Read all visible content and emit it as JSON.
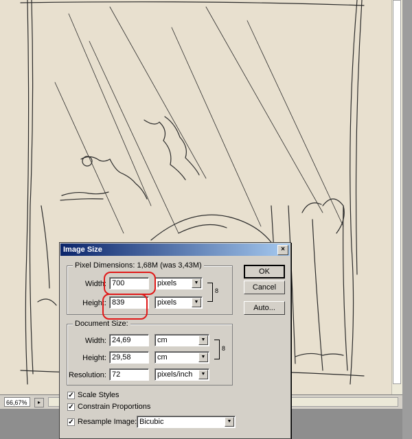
{
  "status": {
    "zoom": "66,67%"
  },
  "dialog": {
    "title": "Image Size",
    "close_icon": "×",
    "pixel_dimensions": {
      "legend": "Pixel Dimensions:",
      "size_info": "1,68M (was 3,43M)",
      "width_label": "Width:",
      "width_value": "700",
      "width_unit": "pixels",
      "height_label": "Height:",
      "height_value": "839",
      "height_unit": "pixels"
    },
    "document_size": {
      "legend": "Document Size:",
      "width_label": "Width:",
      "width_value": "24,69",
      "width_unit": "cm",
      "height_label": "Height:",
      "height_value": "29,58",
      "height_unit": "cm",
      "resolution_label": "Resolution:",
      "resolution_value": "72",
      "resolution_unit": "pixels/inch"
    },
    "buttons": {
      "ok": "OK",
      "cancel": "Cancel",
      "auto": "Auto..."
    },
    "checkboxes": {
      "scale_styles": {
        "label": "Scale Styles",
        "checked": true
      },
      "constrain_proportions": {
        "label": "Constrain Proportions",
        "checked": true
      },
      "resample_image": {
        "label": "Resample Image:",
        "checked": true
      }
    },
    "resample_method": "Bicubic",
    "check_mark": "✓",
    "dropdown_arrow": "▼",
    "link_icon": "8"
  },
  "colors": {
    "annotation": "#e01818",
    "canvas": "#e8e0cf",
    "titlebar": "#0a246a"
  }
}
